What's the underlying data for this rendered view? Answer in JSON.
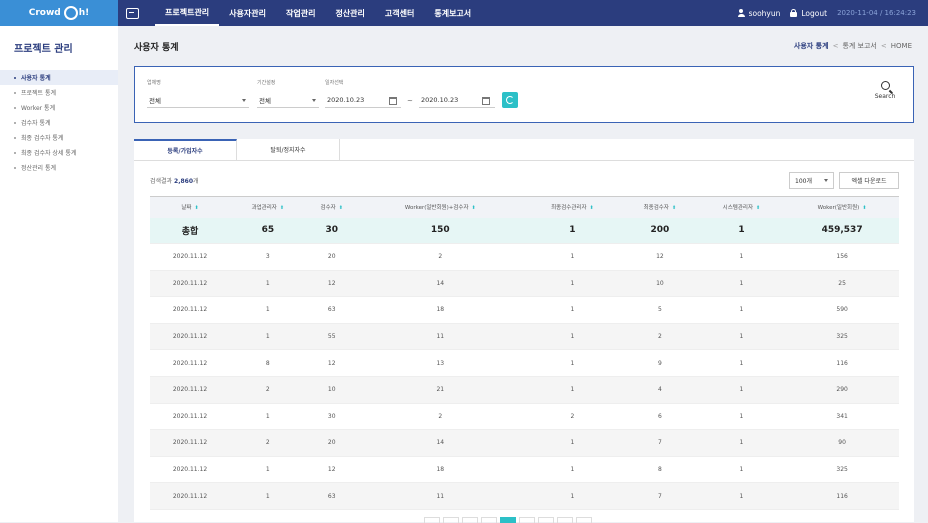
{
  "app": {
    "logo_text": "Crowd",
    "logo_suffix": "h!"
  },
  "nav": {
    "items": [
      "프로젝트관리",
      "사용자관리",
      "작업관리",
      "정산관리",
      "고객센터",
      "통계보고서"
    ]
  },
  "user": {
    "name": "soohyun",
    "logout": "Logout",
    "datetime": "2020-11-04 / 16:24:23"
  },
  "sidebar": {
    "title": "프로젝트 관리",
    "items": [
      "사용자 통계",
      "프로젝트 통계",
      "Worker 통계",
      "검수자 통계",
      "최종 검수자 통계",
      "최종 검수자 상세 통계",
      "정산관리 통계"
    ]
  },
  "page": {
    "title": "사용자 통계"
  },
  "breadcrumb": {
    "current": "사용자 통계",
    "parent": "통계 보고서",
    "home": "HOME",
    "sep": "<"
  },
  "filter": {
    "type_label": "업체명",
    "type_value": "전체",
    "period_label": "기간설정",
    "period_value": "전체",
    "date_label": "일자선택",
    "date_from": "2020.10.23",
    "date_to": "2020.10.23",
    "tilde": "~",
    "search_label": "Search"
  },
  "tabs": [
    "등록/가입자수",
    "탈퇴/정지자수"
  ],
  "result": {
    "prefix": "검색결과",
    "count": "2,860",
    "suffix": "개"
  },
  "page_size": "100개",
  "excel_label": "엑셀 다운로드",
  "table": {
    "headers": [
      "날짜",
      "과업관리자",
      "검수자",
      "Worker(일반회원)+검수자",
      "최종검수관리자",
      "최종검수자",
      "시스템관리자",
      "Woker(일반회원)"
    ],
    "sort_glyph": "⬍",
    "total": [
      "총합",
      "65",
      "30",
      "150",
      "1",
      "200",
      "1",
      "459,537"
    ],
    "rows": [
      [
        "2020.11.12",
        "3",
        "20",
        "2",
        "1",
        "12",
        "1",
        "156"
      ],
      [
        "2020.11.12",
        "1",
        "12",
        "14",
        "1",
        "10",
        "1",
        "25"
      ],
      [
        "2020.11.12",
        "1",
        "63",
        "18",
        "1",
        "5",
        "1",
        "590"
      ],
      [
        "2020.11.12",
        "1",
        "55",
        "11",
        "1",
        "2",
        "1",
        "325"
      ],
      [
        "2020.11.12",
        "8",
        "12",
        "13",
        "1",
        "9",
        "1",
        "116"
      ],
      [
        "2020.11.12",
        "2",
        "10",
        "21",
        "1",
        "4",
        "1",
        "290"
      ],
      [
        "2020.11.12",
        "1",
        "30",
        "2",
        "2",
        "6",
        "1",
        "341"
      ],
      [
        "2020.11.12",
        "2",
        "20",
        "14",
        "1",
        "7",
        "1",
        "90"
      ],
      [
        "2020.11.12",
        "1",
        "12",
        "18",
        "1",
        "8",
        "1",
        "325"
      ],
      [
        "2020.11.12",
        "1",
        "63",
        "11",
        "1",
        "7",
        "1",
        "116"
      ]
    ]
  },
  "colors": {
    "primary": "#2b3d7e",
    "accent": "#2cc0c7",
    "logo_bg": "#3a8fd6"
  }
}
